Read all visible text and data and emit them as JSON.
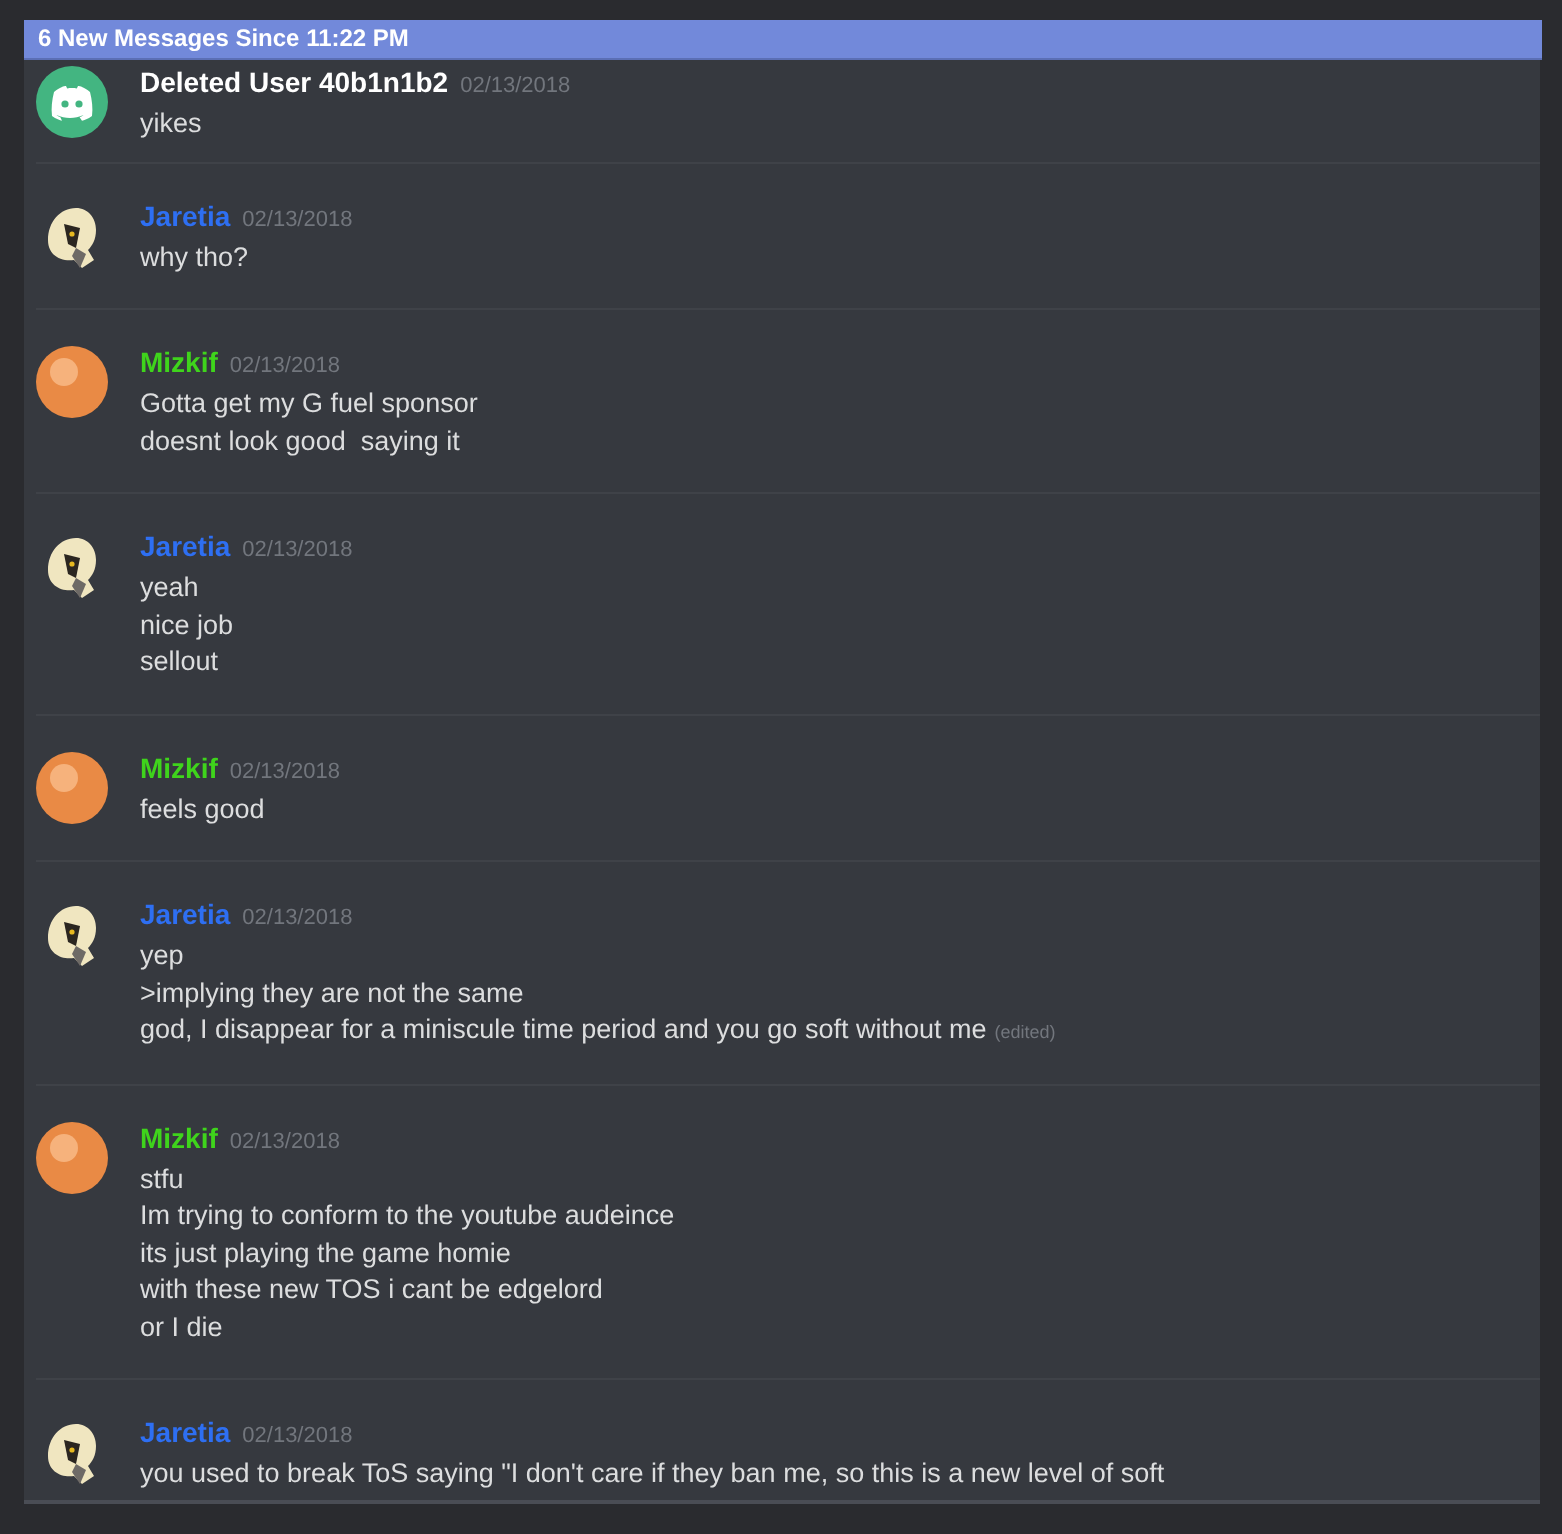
{
  "banner": {
    "text": "6 New Messages Since 11:22 PM"
  },
  "messages": [
    {
      "author": "Deleted User 40b1n1b2",
      "color": "#ffffff",
      "kind": "discord",
      "time": "02/13/2018",
      "lines": [
        "yikes"
      ]
    },
    {
      "author": "Jaretia",
      "color": "#2e6ff2",
      "kind": "creature",
      "time": "02/13/2018",
      "lines": [
        "why tho?"
      ]
    },
    {
      "author": "Mizkif",
      "color": "#3fd41c",
      "kind": "round",
      "time": "02/13/2018",
      "lines": [
        "Gotta get my G fuel sponsor",
        "doesnt look good  saying it"
      ]
    },
    {
      "author": "Jaretia",
      "color": "#2e6ff2",
      "kind": "creature",
      "time": "02/13/2018",
      "lines": [
        "yeah",
        "nice job",
        "sellout"
      ]
    },
    {
      "author": "Mizkif",
      "color": "#3fd41c",
      "kind": "round",
      "time": "02/13/2018",
      "lines": [
        "feels good"
      ]
    },
    {
      "author": "Jaretia",
      "color": "#2e6ff2",
      "kind": "creature",
      "time": "02/13/2018",
      "lines": [
        "yep",
        ">implying they are not the same",
        "god, I disappear for a miniscule time period and you go soft without me"
      ],
      "edited_label": "(edited)"
    },
    {
      "author": "Mizkif",
      "color": "#3fd41c",
      "kind": "round",
      "time": "02/13/2018",
      "lines": [
        "stfu",
        "Im trying to conform to the youtube audeince",
        "its just playing the game homie",
        "with these new TOS i cant be edgelord",
        "or I die"
      ]
    },
    {
      "author": "Jaretia",
      "color": "#2e6ff2",
      "kind": "creature",
      "time": "02/13/2018",
      "lines": [
        "you used to break ToS saying \"I don't care if they ban me, so this is a new level of soft"
      ]
    }
  ]
}
